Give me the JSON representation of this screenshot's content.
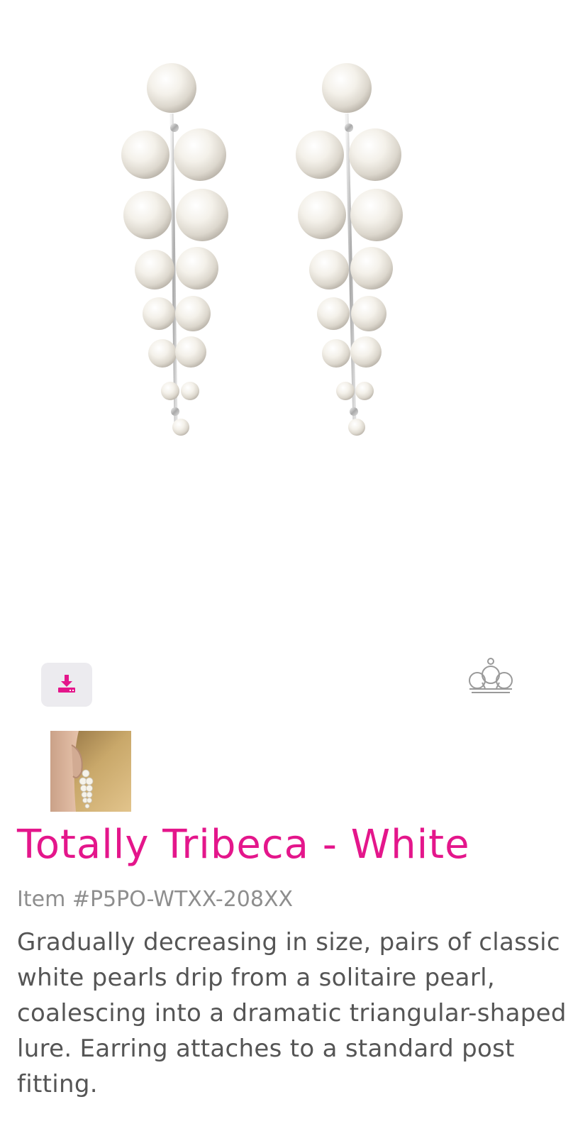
{
  "product": {
    "title": "Totally Tribeca - White",
    "item_number": "Item #P5PO-WTXX-208XX",
    "description": "Gradually decreasing in size, pairs of classic white pearls drip from a solitaire pearl, coalescing into a dramatic triangular-shaped lure. Earring attaches to a standard post fitting."
  },
  "media": {
    "main_image_alt": "Pearl earrings",
    "thumbnail_alt": "Earring worn on model"
  },
  "icons": {
    "download": "download-icon",
    "brand": "crown-icon"
  },
  "colors": {
    "accent": "#e4168b",
    "sku_text": "#8e8e8e",
    "body_text": "#555555",
    "button_bg": "#ecebef"
  }
}
